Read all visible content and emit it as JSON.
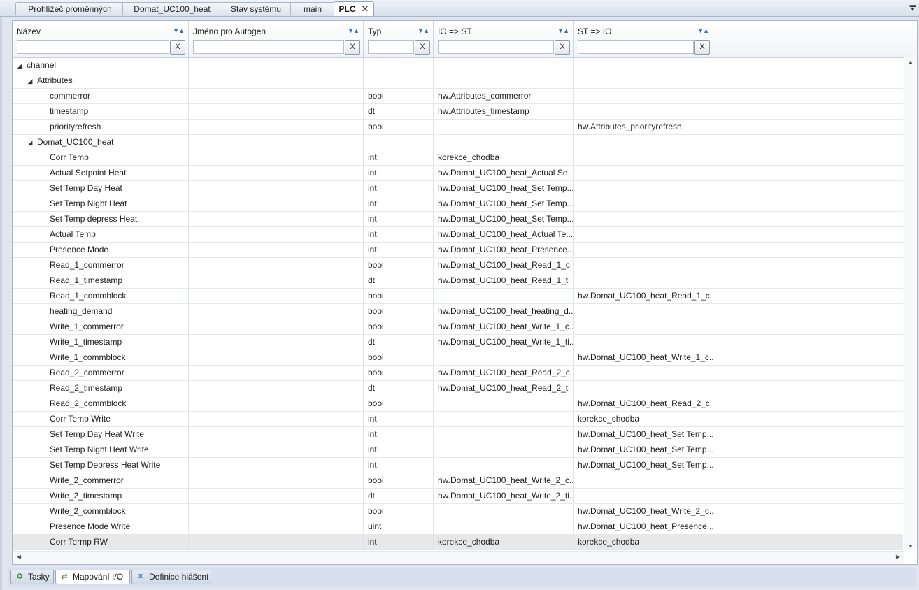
{
  "tabs": [
    {
      "label": "Prohlížeč proměnných"
    },
    {
      "label": "Domat_UC100_heat"
    },
    {
      "label": "Stav systému"
    },
    {
      "label": "main"
    },
    {
      "label": "PLC",
      "close": "✕"
    }
  ],
  "columns": [
    {
      "title": "Název",
      "filter_value": "",
      "clear": "X"
    },
    {
      "title": "Jméno pro Autogen",
      "filter_value": "",
      "clear": "X"
    },
    {
      "title": "Typ",
      "filter_value": "",
      "clear": "X"
    },
    {
      "title": "IO => ST",
      "filter_value": "",
      "clear": "X"
    },
    {
      "title": "ST => IO",
      "filter_value": "",
      "clear": "X"
    }
  ],
  "rows": [
    {
      "level": 0,
      "expanded": true,
      "name": "channel",
      "autogen": "",
      "type": "",
      "io_st": "",
      "st_io": ""
    },
    {
      "level": 1,
      "expanded": true,
      "name": "Attributes",
      "autogen": "",
      "type": "",
      "io_st": "",
      "st_io": ""
    },
    {
      "level": 2,
      "name": "commerror",
      "autogen": "",
      "type": "bool",
      "io_st": "hw.Attributes_commerror",
      "st_io": ""
    },
    {
      "level": 2,
      "name": "timestamp",
      "autogen": "",
      "type": "dt",
      "io_st": "hw.Attributes_timestamp",
      "st_io": ""
    },
    {
      "level": 2,
      "name": "priorityrefresh",
      "autogen": "",
      "type": "bool",
      "io_st": "",
      "st_io": "hw.Attributes_priorityrefresh"
    },
    {
      "level": 1,
      "expanded": true,
      "name": "Domat_UC100_heat",
      "autogen": "",
      "type": "",
      "io_st": "",
      "st_io": ""
    },
    {
      "level": 2,
      "name": "Corr Temp",
      "autogen": "",
      "type": "int",
      "io_st": "korekce_chodba",
      "st_io": ""
    },
    {
      "level": 2,
      "name": "Actual Setpoint Heat",
      "autogen": "",
      "type": "int",
      "io_st": "hw.Domat_UC100_heat_Actual Se...",
      "st_io": ""
    },
    {
      "level": 2,
      "name": "Set Temp Day Heat",
      "autogen": "",
      "type": "int",
      "io_st": "hw.Domat_UC100_heat_Set Temp...",
      "st_io": ""
    },
    {
      "level": 2,
      "name": "Set Temp Night Heat",
      "autogen": "",
      "type": "int",
      "io_st": "hw.Domat_UC100_heat_Set Temp...",
      "st_io": ""
    },
    {
      "level": 2,
      "name": "Set Temp depress Heat",
      "autogen": "",
      "type": "int",
      "io_st": "hw.Domat_UC100_heat_Set Temp...",
      "st_io": ""
    },
    {
      "level": 2,
      "name": "Actual Temp",
      "autogen": "",
      "type": "int",
      "io_st": "hw.Domat_UC100_heat_Actual Te...",
      "st_io": ""
    },
    {
      "level": 2,
      "name": "Presence Mode",
      "autogen": "",
      "type": "int",
      "io_st": "hw.Domat_UC100_heat_Presence...",
      "st_io": ""
    },
    {
      "level": 2,
      "name": "Read_1_commerror",
      "autogen": "",
      "type": "bool",
      "io_st": "hw.Domat_UC100_heat_Read_1_c...",
      "st_io": ""
    },
    {
      "level": 2,
      "name": "Read_1_timestamp",
      "autogen": "",
      "type": "dt",
      "io_st": "hw.Domat_UC100_heat_Read_1_ti...",
      "st_io": ""
    },
    {
      "level": 2,
      "name": "Read_1_commblock",
      "autogen": "",
      "type": "bool",
      "io_st": "",
      "st_io": "hw.Domat_UC100_heat_Read_1_c..."
    },
    {
      "level": 2,
      "name": "heating_demand",
      "autogen": "",
      "type": "bool",
      "io_st": "hw.Domat_UC100_heat_heating_d...",
      "st_io": ""
    },
    {
      "level": 2,
      "name": "Write_1_commerror",
      "autogen": "",
      "type": "bool",
      "io_st": "hw.Domat_UC100_heat_Write_1_c...",
      "st_io": ""
    },
    {
      "level": 2,
      "name": "Write_1_timestamp",
      "autogen": "",
      "type": "dt",
      "io_st": "hw.Domat_UC100_heat_Write_1_ti...",
      "st_io": ""
    },
    {
      "level": 2,
      "name": "Write_1_commblock",
      "autogen": "",
      "type": "bool",
      "io_st": "",
      "st_io": "hw.Domat_UC100_heat_Write_1_c..."
    },
    {
      "level": 2,
      "name": "Read_2_commerror",
      "autogen": "",
      "type": "bool",
      "io_st": "hw.Domat_UC100_heat_Read_2_c...",
      "st_io": ""
    },
    {
      "level": 2,
      "name": "Read_2_timestamp",
      "autogen": "",
      "type": "dt",
      "io_st": "hw.Domat_UC100_heat_Read_2_ti...",
      "st_io": ""
    },
    {
      "level": 2,
      "name": "Read_2_commblock",
      "autogen": "",
      "type": "bool",
      "io_st": "",
      "st_io": "hw.Domat_UC100_heat_Read_2_c..."
    },
    {
      "level": 2,
      "name": "Corr Temp Write",
      "autogen": "",
      "type": "int",
      "io_st": "",
      "st_io": "korekce_chodba"
    },
    {
      "level": 2,
      "name": "Set Temp Day Heat Write",
      "autogen": "",
      "type": "int",
      "io_st": "",
      "st_io": "hw.Domat_UC100_heat_Set Temp..."
    },
    {
      "level": 2,
      "name": "Set Temp Night Heat Write",
      "autogen": "",
      "type": "int",
      "io_st": "",
      "st_io": "hw.Domat_UC100_heat_Set Temp..."
    },
    {
      "level": 2,
      "name": "Set Temp Depress Heat Write",
      "autogen": "",
      "type": "int",
      "io_st": "",
      "st_io": "hw.Domat_UC100_heat_Set Temp..."
    },
    {
      "level": 2,
      "name": "Write_2_commerror",
      "autogen": "",
      "type": "bool",
      "io_st": "hw.Domat_UC100_heat_Write_2_c...",
      "st_io": ""
    },
    {
      "level": 2,
      "name": "Write_2_timestamp",
      "autogen": "",
      "type": "dt",
      "io_st": "hw.Domat_UC100_heat_Write_2_ti...",
      "st_io": ""
    },
    {
      "level": 2,
      "name": "Write_2_commblock",
      "autogen": "",
      "type": "bool",
      "io_st": "",
      "st_io": "hw.Domat_UC100_heat_Write_2_c..."
    },
    {
      "level": 2,
      "name": "Presence Mode Write",
      "autogen": "",
      "type": "uint",
      "io_st": "",
      "st_io": "hw.Domat_UC100_heat_Presence..."
    },
    {
      "level": 2,
      "name": "Corr Termp RW",
      "autogen": "",
      "type": "int",
      "io_st": "korekce_chodba",
      "st_io": "korekce_chodba",
      "selected": true
    }
  ],
  "bottom_tabs": [
    {
      "label": "Tasky",
      "icon": "tasks-icon"
    },
    {
      "label": "Mapování I/O",
      "icon": "io-mapping-icon",
      "active": true
    },
    {
      "label": "Definice hlášení",
      "icon": "message-definition-icon"
    }
  ],
  "colors": {
    "accent": "#3a6fc0",
    "selected_row": "#e8e8e8",
    "tab_border": "#a9b6c8"
  }
}
